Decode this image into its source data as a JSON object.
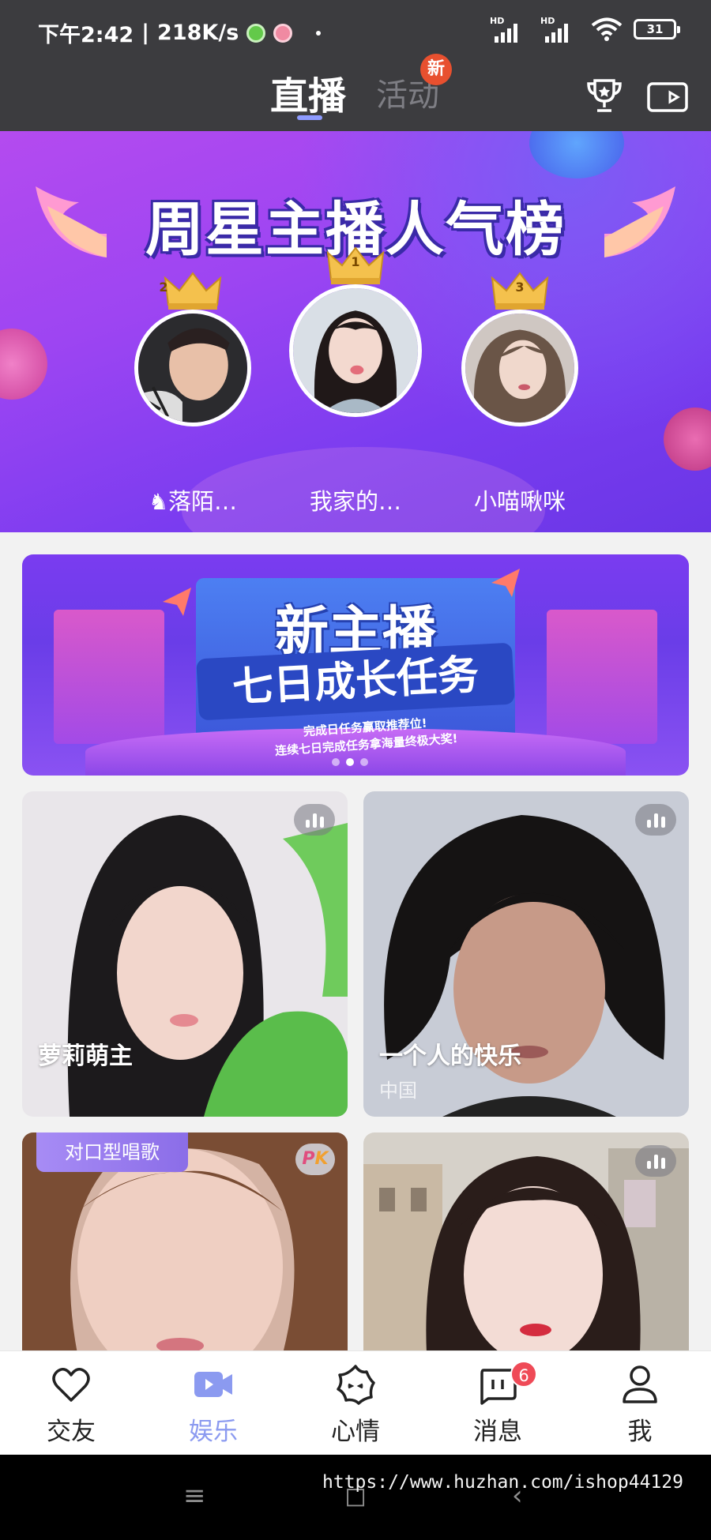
{
  "status_bar": {
    "time": "下午2:42",
    "net_speed": "218K/s",
    "signal_label_1": "HD",
    "signal_label_2": "HD",
    "battery": "31"
  },
  "top_nav": {
    "tab_live": "直播",
    "tab_activity": "活动",
    "new_badge": "新",
    "icons": [
      "trophy-icon",
      "video-camera-icon"
    ]
  },
  "ranking": {
    "title": "周星主播人气榜",
    "entries": [
      {
        "rank": "2",
        "name": "落陌…",
        "name_prefix": "♞"
      },
      {
        "rank": "1",
        "name": "我家的…"
      },
      {
        "rank": "3",
        "name": "小喵啾咪"
      }
    ]
  },
  "promo": {
    "title_line1": "新主播",
    "title_line2": "七日成长任务",
    "sub_line1": "完成日任务赢取推荐位!",
    "sub_line2": "连续七日完成任务拿海量终极大奖!",
    "pages": 3,
    "active_page": 2
  },
  "streams": [
    {
      "name": "萝莉萌主",
      "location": ""
    },
    {
      "name": "一个人的快乐",
      "location": "中国"
    },
    {
      "tag": "对口型唱歌",
      "badge": "PK"
    },
    {
      "name": ""
    }
  ],
  "bottom_nav": {
    "items": [
      {
        "label": "交友",
        "icon": "heart-icon"
      },
      {
        "label": "娱乐",
        "icon": "video-icon"
      },
      {
        "label": "心情",
        "icon": "mood-face-icon"
      },
      {
        "label": "消息",
        "icon": "message-icon"
      },
      {
        "label": "我",
        "icon": "profile-icon"
      }
    ],
    "message_badge": "6",
    "active": "娱乐"
  },
  "system_bar": {
    "keys": [
      "≡",
      "◻",
      "‹"
    ]
  },
  "watermark": "https://www.huzhan.com/ishop44129",
  "colors": {
    "header_bg": "#3c3c3f",
    "accent": "#8b9af0",
    "badge_red": "#ef4a57",
    "new_badge": "#e8502f"
  }
}
